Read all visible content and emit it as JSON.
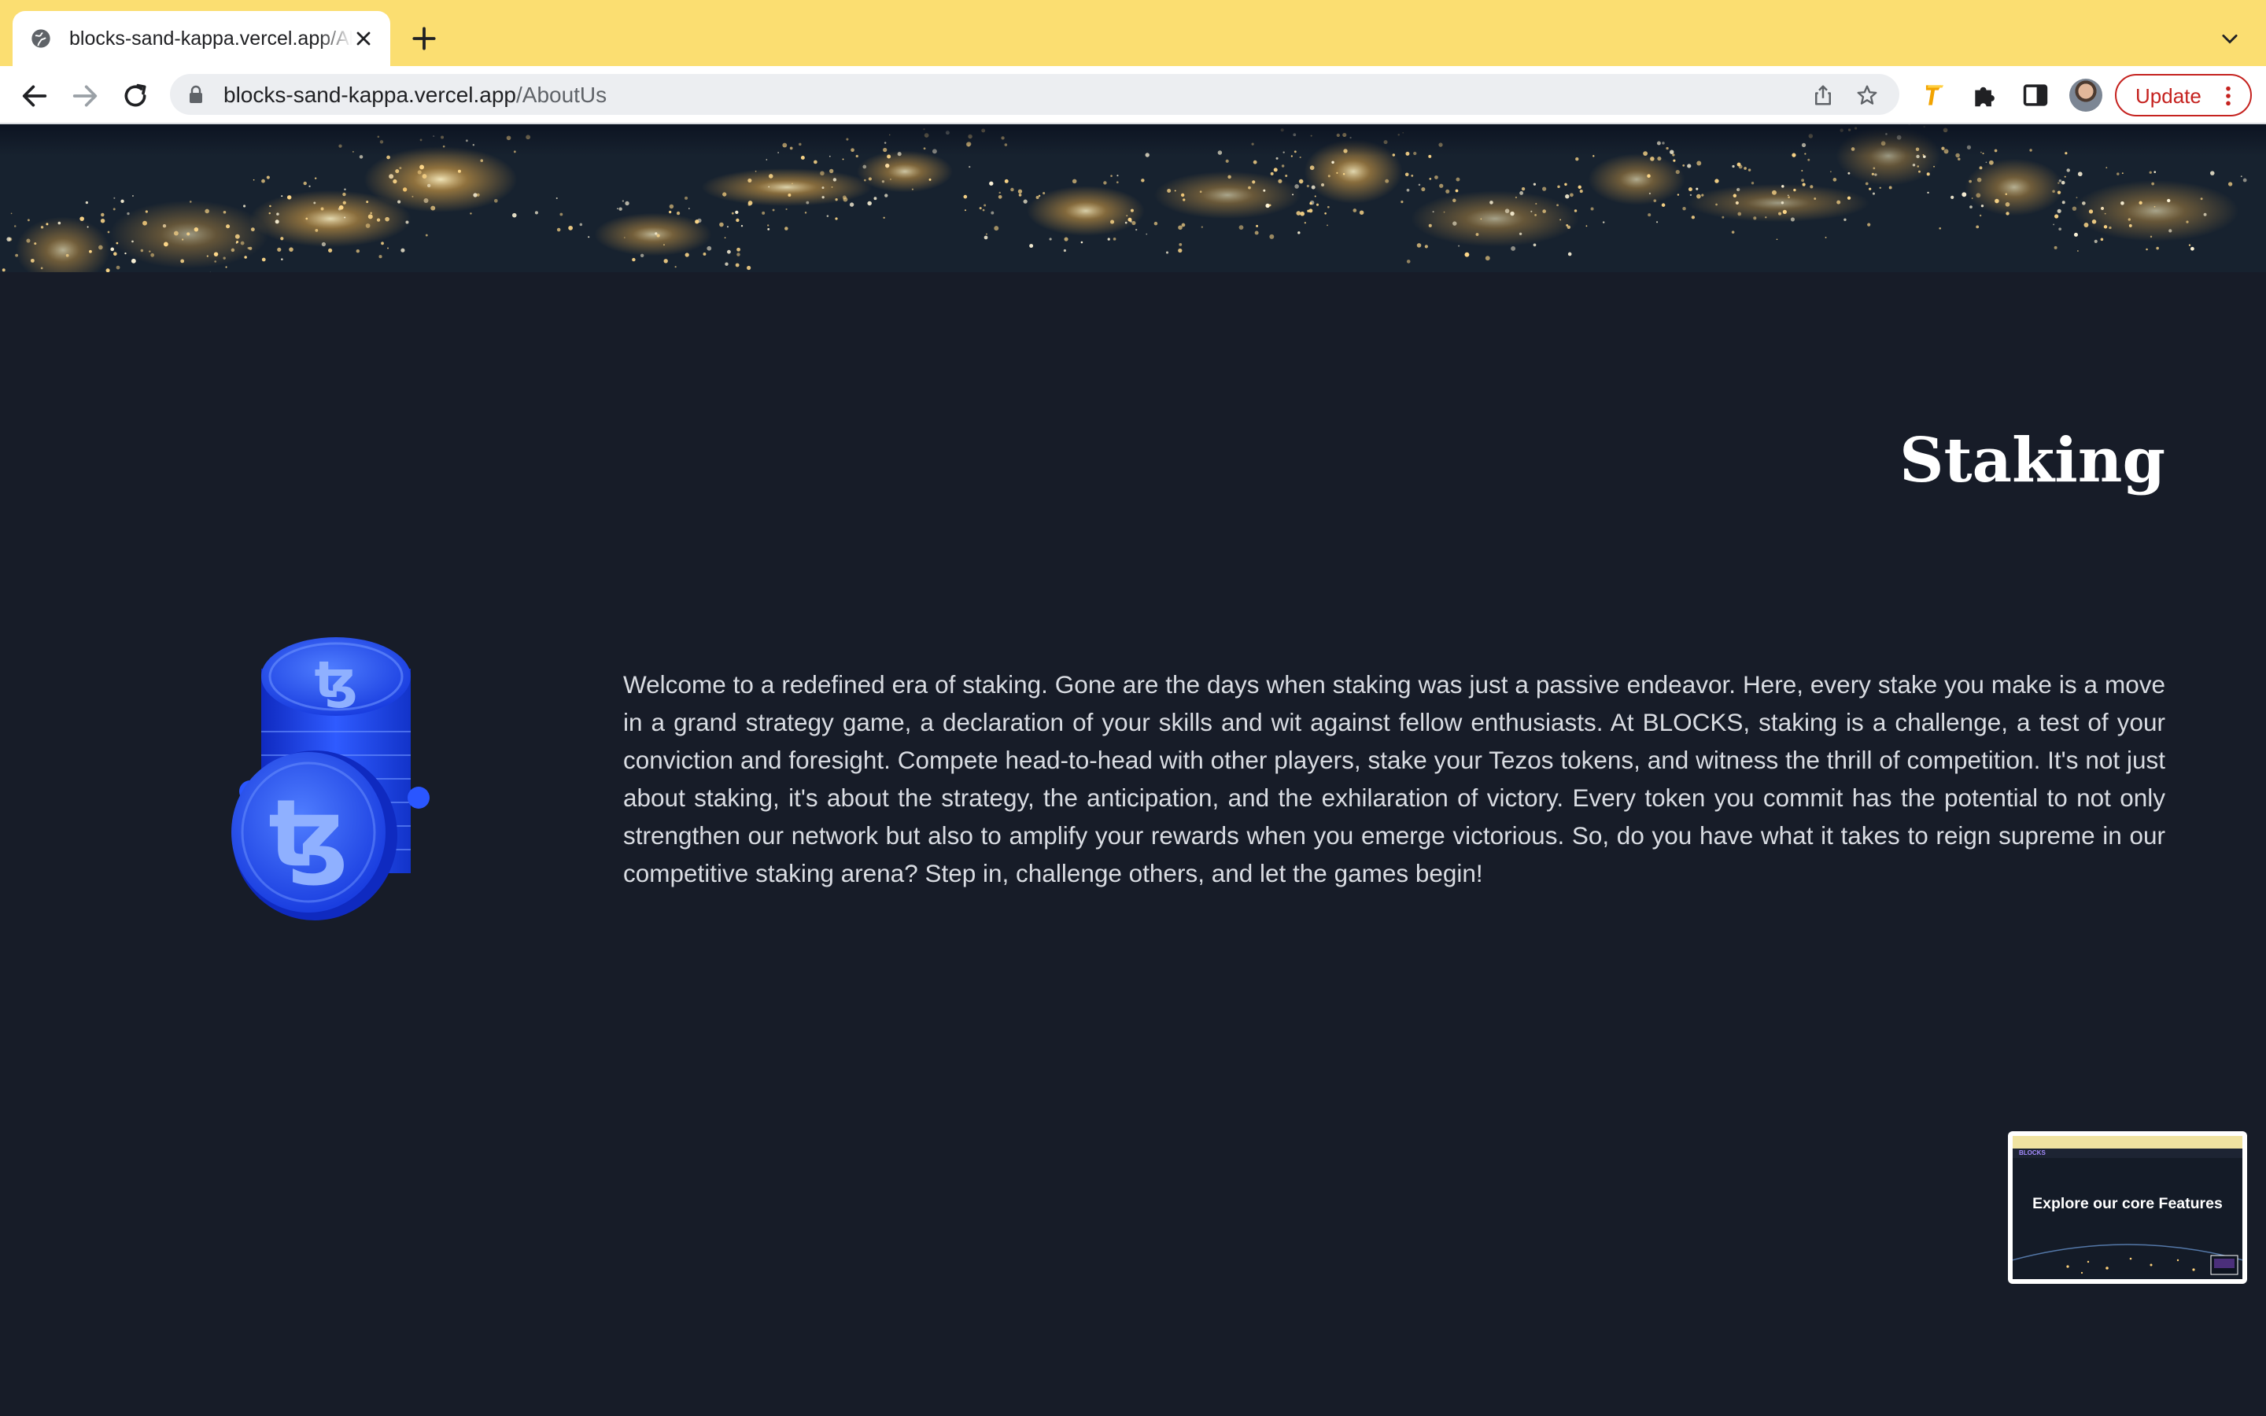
{
  "browser": {
    "tab": {
      "title": "blocks-sand-kappa.vercel.app/AboutUs",
      "favicon": "globe-icon",
      "close_icon": "close-icon"
    },
    "new_tab_icon": "plus-icon",
    "tab_search_icon": "chevron-down-icon",
    "nav": {
      "back_icon": "arrow-left-icon",
      "forward_icon": "arrow-right-icon",
      "reload_icon": "reload-icon"
    },
    "address": {
      "host": "blocks-sand-kappa.vercel.app",
      "path": "/AboutUs",
      "lock_icon": "lock-icon"
    },
    "omnibox_actions": [
      "share-icon",
      "star-icon"
    ],
    "extensions": [
      "key-extension-icon",
      "puzzle-icon",
      "sidepanel-icon"
    ],
    "update_label": "Update",
    "colors": {
      "tabstrip": "#fbde71",
      "update": "#c5221f"
    }
  },
  "page": {
    "background": "#171c28",
    "heading": "Staking",
    "image": "tezos-coin-stack-image",
    "paragraph": "Welcome to a redefined era of staking. Gone are the days when staking was just a passive endeavor. Here, every stake you make is a move in a grand strategy game, a declaration of your skills and wit against fellow enthusiasts. At BLOCKS, staking is a challenge, a test of your conviction and foresight. Compete head-to-head with other players, stake your Tezos tokens, and witness the thrill of competition. It's not just about staking, it's about the strategy, the anticipation, and the exhilaration of victory. Every token you commit has the potential to not only strengthen our network but also to amplify your rewards when you emerge victorious. So, do you have what it takes to reign supreme in our competitive staking arena? Step in, challenge others, and let the games begin!",
    "preview_thumbnail": {
      "logo": "BLOCKS",
      "caption": "Explore our core Features"
    }
  }
}
